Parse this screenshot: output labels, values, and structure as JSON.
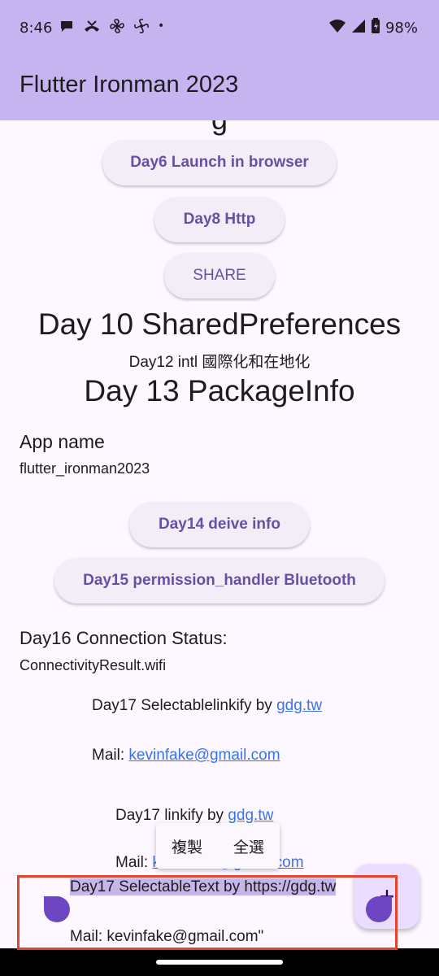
{
  "status_bar": {
    "time": "8:46",
    "notification_icons": [
      "chat-icon",
      "missed-call-icon",
      "pinwheel-icon",
      "pinwheel-icon",
      "dot-icon"
    ],
    "battery": "98%"
  },
  "app_bar": {
    "title": "Flutter Ironman 2023"
  },
  "content": {
    "cut_text": "g",
    "btn_day6": "Day6 Launch in browser",
    "btn_day8": "Day8 Http",
    "btn_share": "SHARE",
    "day10_title": "Day 10 SharedPreferences",
    "day12_text": "Day12 intl 國際化和在地化",
    "day13_title": "Day 13 PackageInfo",
    "app_name_label": "App name",
    "app_name_value": "flutter_ironman2023",
    "btn_day14": "Day14 deive info",
    "btn_day15": "Day15 permission_handler Bluetooth",
    "day16_label": "Day16 Connection Status:",
    "day16_value": "ConnectivityResult.wifi",
    "day17_selectable_linkify": "Day17 Selectablelinkify by ",
    "day17_selectable_linkify_link": "gdg.tw",
    "mail1_label": "Mail: ",
    "mail1_link": "kevinfake@gmail.com",
    "day17_linkify": "Day17 linkify by ",
    "day17_linkify_link": "gdg.tw",
    "mail2_label": "Mail: ",
    "mail2_link": "kevinfake@gmail.com",
    "day17_selectable_text": "Day17 SelectableText by https://gdg.tw",
    "mail3_text": "Mail: kevinfake@gmail.com\""
  },
  "context_menu": {
    "copy": "複製",
    "select_all": "全選"
  },
  "fab": {
    "icon": "plus-icon",
    "label": "+"
  },
  "colors": {
    "app_bar": "#c5b4f0",
    "background": "#fdf7ff",
    "button_text": "#6750a4",
    "link": "#3b73e8",
    "highlight_border": "#e2452d",
    "selection_handle": "#6e45c3"
  }
}
